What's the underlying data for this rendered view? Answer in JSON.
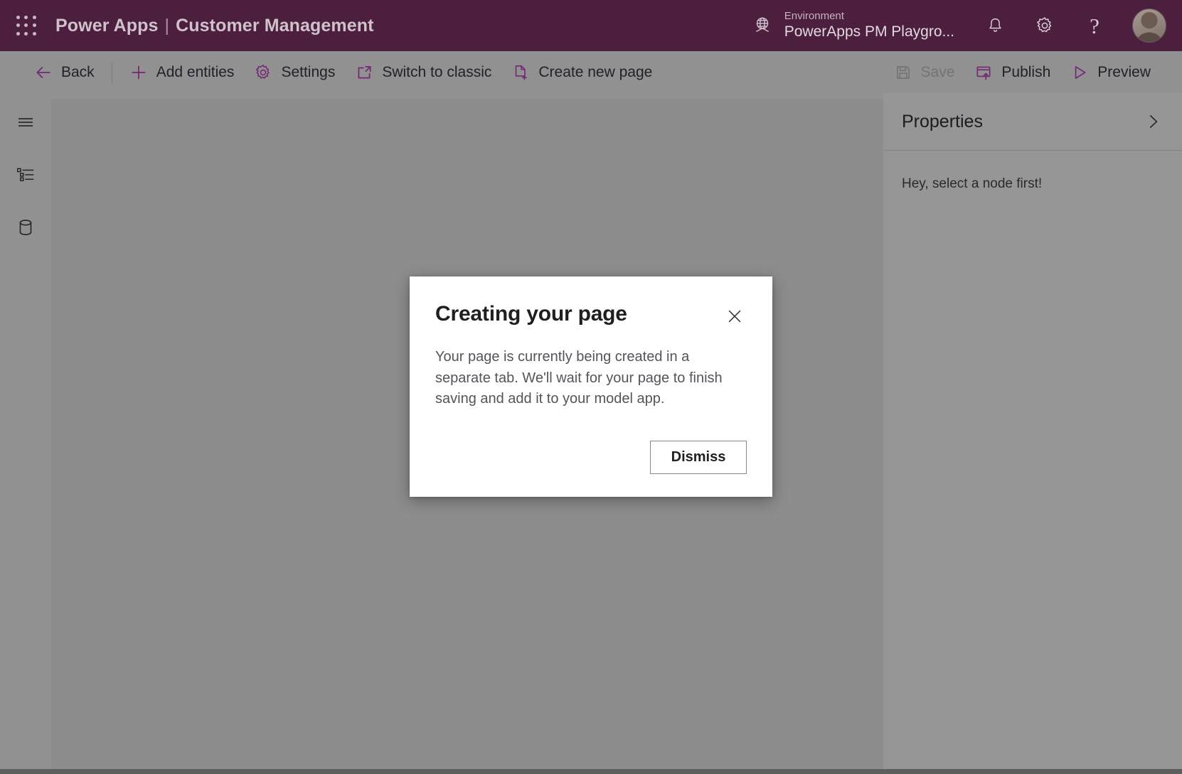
{
  "topbar": {
    "waffle_icon": "app-launcher-waffle-icon",
    "product": "Power Apps",
    "separator": "|",
    "app_title": "Customer Management",
    "environment": {
      "icon": "globe-environment-icon",
      "label": "Environment",
      "name": "PowerApps PM Playgro..."
    },
    "notification_icon": "bell-icon",
    "settings_icon": "gear-icon",
    "help_icon": "question-mark-icon",
    "avatar": "user-avatar",
    "background_color": "#4c1f3f"
  },
  "commandbar": {
    "background_color": "#919191",
    "accent_color": "#742774",
    "left_items": [
      {
        "id": "back",
        "label": "Back",
        "icon": "arrow-left-icon",
        "disabled": false
      },
      {
        "id": "add-entities",
        "label": "Add entities",
        "icon": "plus-icon",
        "disabled": false
      },
      {
        "id": "settings",
        "label": "Settings",
        "icon": "gear-icon",
        "disabled": false
      },
      {
        "id": "switch-to-classic",
        "label": "Switch to classic",
        "icon": "open-in-new-window-icon",
        "disabled": false
      },
      {
        "id": "create-new-page",
        "label": "Create new page",
        "icon": "new-page-icon",
        "disabled": false
      }
    ],
    "right_items": [
      {
        "id": "save",
        "label": "Save",
        "icon": "floppy-disk-icon",
        "disabled": true
      },
      {
        "id": "publish",
        "label": "Publish",
        "icon": "publish-upload-icon",
        "disabled": false
      },
      {
        "id": "preview",
        "label": "Preview",
        "icon": "play-triangle-icon",
        "disabled": false
      }
    ]
  },
  "rail": {
    "items": [
      {
        "id": "menu",
        "icon": "hamburger-menu-icon"
      },
      {
        "id": "tree-view",
        "icon": "tree-list-icon"
      },
      {
        "id": "data",
        "icon": "database-cylinder-icon"
      }
    ]
  },
  "properties_panel": {
    "title": "Properties",
    "collapse_icon": "chevron-right-icon",
    "empty_message": "Hey, select a node first!"
  },
  "dialog": {
    "title": "Creating your page",
    "close_icon": "close-x-icon",
    "body": "Your page is currently being created in a separate tab. We'll wait for your page to finish saving and add it to your model app.",
    "dismiss_label": "Dismiss"
  }
}
